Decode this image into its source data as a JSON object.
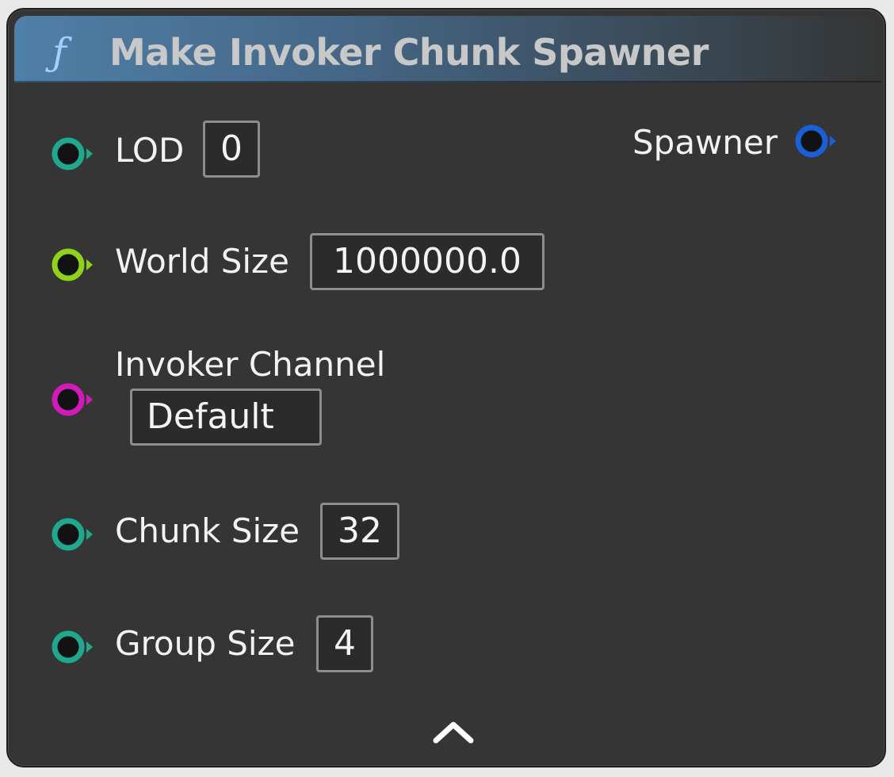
{
  "node": {
    "title": "Make Invoker Chunk Spawner",
    "title_icon": "function-icon",
    "header_color": "#4f7fa7"
  },
  "inputs": [
    {
      "name": "lod",
      "label": "LOD",
      "value": "0",
      "pin_color": "#1fa88e"
    },
    {
      "name": "world-size",
      "label": "World Size",
      "value": "1000000.0",
      "pin_color": "#8fd21a"
    },
    {
      "name": "invoker-channel",
      "label": "Invoker Channel",
      "value": "Default",
      "pin_color": "#d11ab8"
    },
    {
      "name": "chunk-size",
      "label": "Chunk Size",
      "value": "32",
      "pin_color": "#1fa88e"
    },
    {
      "name": "group-size",
      "label": "Group Size",
      "value": "4",
      "pin_color": "#1fa88e"
    }
  ],
  "outputs": [
    {
      "name": "spawner",
      "label": "Spawner",
      "pin_color": "#1a5fd6"
    }
  ],
  "footer": {
    "collapse_icon": "chevron-up-icon"
  }
}
